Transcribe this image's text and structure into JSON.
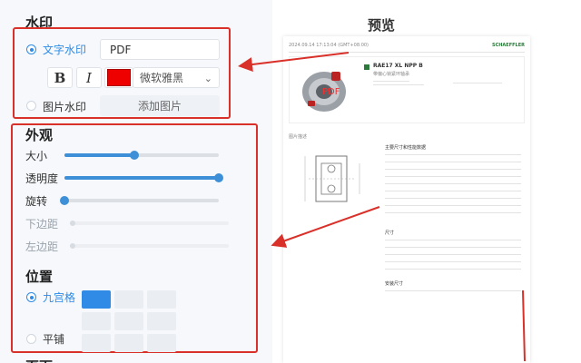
{
  "watermark": {
    "title": "水印",
    "text_option_label": "文字水印",
    "text_value": "PDF",
    "bold_label": "B",
    "italic_label": "I",
    "color": "#ee0000",
    "font_value": "微软雅黑",
    "image_option_label": "图片水印",
    "add_image_label": "添加图片"
  },
  "appearance": {
    "title": "外观",
    "size_label": "大小",
    "size_value": 0.45,
    "opacity_label": "透明度",
    "opacity_value": 1.0,
    "rotation_label": "旋转",
    "rotation_value": 0.0,
    "bottom_margin_label": "下边距",
    "left_margin_label": "左边距"
  },
  "position": {
    "title": "位置",
    "grid_label": "九宫格",
    "grid_selected_cell": 0,
    "tile_label": "平铺"
  },
  "next_section_title": "页面",
  "preview": {
    "title": "预览",
    "header_left": "2024.09.14 17:13:04 (GMT+08:00)",
    "brand": "SCHAEFFLER",
    "product": "RAE17 XL NPP B",
    "subtitle": "带偏心锁紧环轴承",
    "watermark_text": "PDF",
    "section_label": "图片描述",
    "table_title": "主要尺寸和性能数据",
    "block2": "尺寸",
    "block3": "安装尺寸"
  }
}
